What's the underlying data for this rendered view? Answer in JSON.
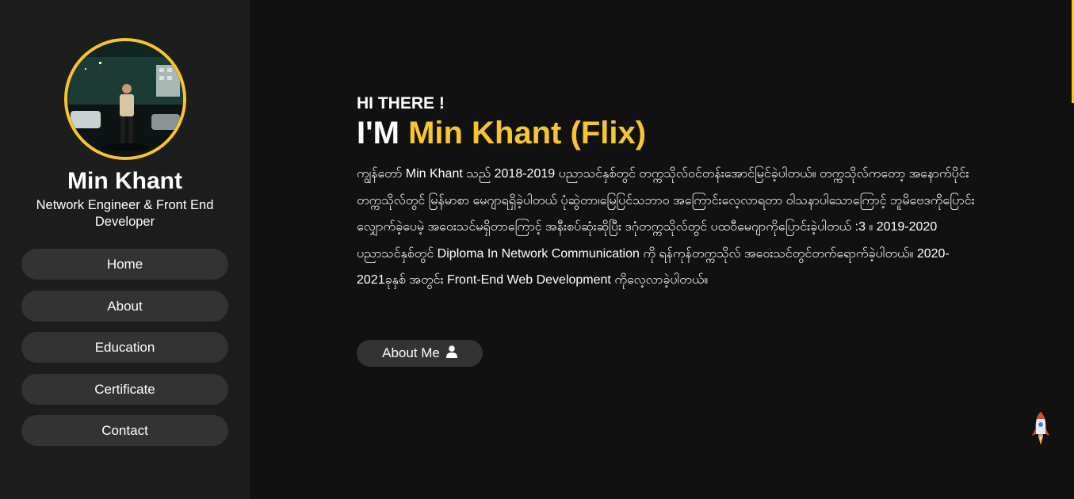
{
  "sidebar": {
    "name": "Min Khant",
    "role": "Network Engineer & Front End Developer",
    "nav": [
      "Home",
      "About",
      "Education",
      "Certificate",
      "Contact"
    ]
  },
  "hero": {
    "greeting": "HI THERE !",
    "prefix": "I'M",
    "highlight_name": "Min Khant (Flix)",
    "bio": "ကျွန်တော် Min Khant သည် 2018-2019 ပညာသင်နှစ်တွင် တက္ကသိုလ်ဝင်တန်းအောင်မြင်ခဲ့ပါတယ်။ တက္ကသိုလ်ကတော့ အနောက်ပိုင်းတက္ကသိုလ်တွင် မြန်မာစာ မေဂျာရရှိခဲ့ပါတယ် ပုံဆွဲတာ၊မြေပြင်သဘာဝ အကြောင်းလေ့လာရတာ ဝါသနာပါသောကြောင့် ဘူမိဗေဒကိုပြောင်းလျှောက်ခဲ့ပေမဲ့ အဝေးသင်မရှိတာကြောင့် အနီးစပ်ဆုံးဆိုပြီး ဒဂုံတက္ကသိုလ်တွင် ပထဝီမေဂျာကိုပြောင်းခဲ့ပါတယ် :3 ။ 2019-2020 ပညာသင်နှစ်တွင် Diploma In Network Communication ကို ရန်ကုန်တက္ကသိုလ် အဝေးသင်တွင်တက်ရောက်ခဲ့ပါတယ်။ 2020-2021ခုနှစ် အတွင်း Front-End Web Development ကိုလေ့လာခဲ့ပါတယ်။",
    "about_button": "About Me"
  },
  "icons": {
    "about_button_icon": "user-icon",
    "back_to_top": "rocket-icon"
  },
  "colors": {
    "accent": "#f7c530",
    "sidebar_bg": "#1d1d1e",
    "main_bg": "#111112",
    "button_bg": "#333334"
  }
}
